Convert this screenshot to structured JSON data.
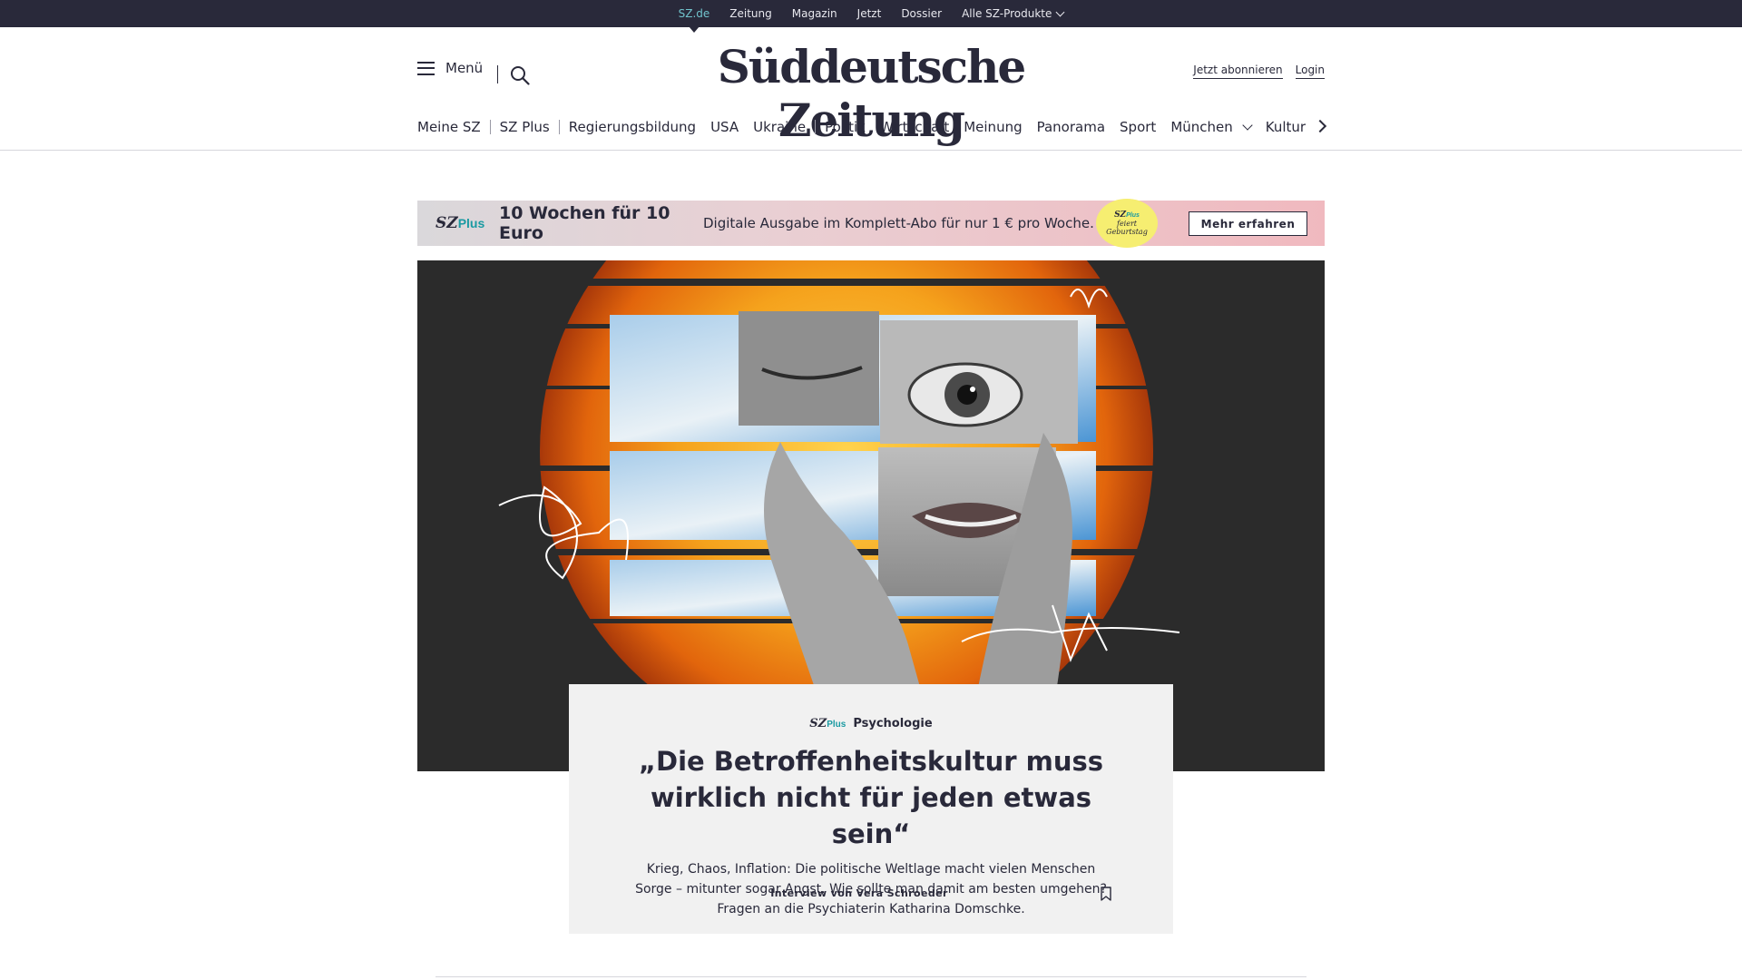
{
  "topbar": {
    "items": [
      {
        "label": "SZ.de"
      },
      {
        "label": "Zeitung"
      },
      {
        "label": "Magazin"
      },
      {
        "label": "Jetzt"
      },
      {
        "label": "Dossier"
      },
      {
        "label": "Alle SZ-Produkte"
      }
    ]
  },
  "header": {
    "menu_label": "Menü",
    "logo": "Süddeutsche Zeitung",
    "subscribe_label": "Jetzt abonnieren",
    "login_label": "Login"
  },
  "nav": {
    "items": [
      {
        "label": "Meine SZ"
      },
      {
        "label": "SZ Plus"
      },
      {
        "label": "Regierungsbildung"
      },
      {
        "label": "USA"
      },
      {
        "label": "Ukraine"
      },
      {
        "label": "Politik"
      },
      {
        "label": "Wirtschaft"
      },
      {
        "label": "Meinung"
      },
      {
        "label": "Panorama"
      },
      {
        "label": "Sport"
      },
      {
        "label": "München"
      },
      {
        "label": "Kultur"
      }
    ]
  },
  "promo": {
    "brand_sz": "SZ",
    "brand_plus": "Plus",
    "headline": "10 Wochen für 10 Euro",
    "subline": "Digitale Ausgabe im Komplett-Abo für nur 1 € pro Woche.",
    "badge_sz": "SZ",
    "badge_plus": "Plus",
    "badge_line1": "feiert",
    "badge_line2": "Geburtstag",
    "cta_label": "Mehr erfahren"
  },
  "article": {
    "kicker_sz": "SZ",
    "kicker_plus": "Plus",
    "kicker": "Psychologie",
    "title": "„Die Betroffenheitskultur muss wirklich nicht für jeden etwas sein“",
    "teaser": "Krieg, Chaos, Inflation: Die politische Weltlage macht vielen Menschen Sorge – mitunter sogar Angst. Wie sollte man damit am besten umgehen? Fragen an die Psychiaterin Katharina Domschke.",
    "byline": "Interview von Vera Schroeder"
  },
  "colors": {
    "brand_dark": "#29293a",
    "active_link": "#71c4cd",
    "plus_accent": "#1a9aa2",
    "badge_yellow": "#f6ee71",
    "promo_pink": "#f0b9bf",
    "card_bg": "#f1f1f1"
  }
}
